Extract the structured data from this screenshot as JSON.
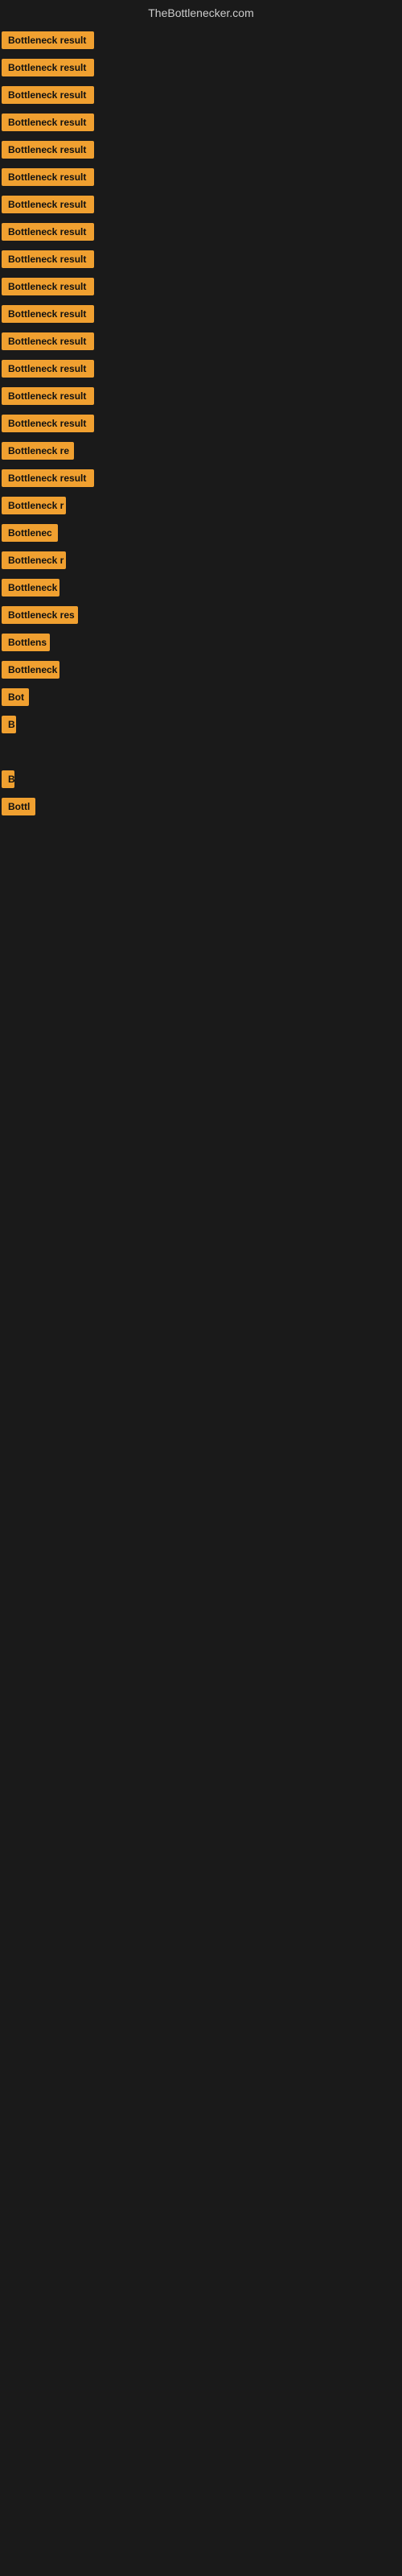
{
  "site": {
    "title": "TheBottlenecker.com"
  },
  "bars": [
    {
      "label": "Bottleneck result",
      "width": 115
    },
    {
      "label": "Bottleneck result",
      "width": 115
    },
    {
      "label": "Bottleneck result",
      "width": 115
    },
    {
      "label": "Bottleneck result",
      "width": 115
    },
    {
      "label": "Bottleneck result",
      "width": 115
    },
    {
      "label": "Bottleneck result",
      "width": 115
    },
    {
      "label": "Bottleneck result",
      "width": 115
    },
    {
      "label": "Bottleneck result",
      "width": 115
    },
    {
      "label": "Bottleneck result",
      "width": 115
    },
    {
      "label": "Bottleneck result",
      "width": 115
    },
    {
      "label": "Bottleneck result",
      "width": 115
    },
    {
      "label": "Bottleneck result",
      "width": 115
    },
    {
      "label": "Bottleneck result",
      "width": 115
    },
    {
      "label": "Bottleneck result",
      "width": 115
    },
    {
      "label": "Bottleneck result",
      "width": 115
    },
    {
      "label": "Bottleneck re",
      "width": 90
    },
    {
      "label": "Bottleneck result",
      "width": 115
    },
    {
      "label": "Bottleneck r",
      "width": 80
    },
    {
      "label": "Bottlenec",
      "width": 70
    },
    {
      "label": "Bottleneck r",
      "width": 80
    },
    {
      "label": "Bottleneck",
      "width": 72
    },
    {
      "label": "Bottleneck res",
      "width": 95
    },
    {
      "label": "Bottlens",
      "width": 60
    },
    {
      "label": "Bottleneck",
      "width": 72
    },
    {
      "label": "Bot",
      "width": 34
    },
    {
      "label": "B",
      "width": 18
    },
    {
      "label": "",
      "width": 0
    },
    {
      "label": "B",
      "width": 16
    },
    {
      "label": "Bottl",
      "width": 42
    },
    {
      "label": "",
      "width": 0
    },
    {
      "label": "",
      "width": 0
    },
    {
      "label": "",
      "width": 0
    },
    {
      "label": "",
      "width": 0
    },
    {
      "label": "",
      "width": 0
    },
    {
      "label": "",
      "width": 0
    },
    {
      "label": "",
      "width": 0
    }
  ]
}
